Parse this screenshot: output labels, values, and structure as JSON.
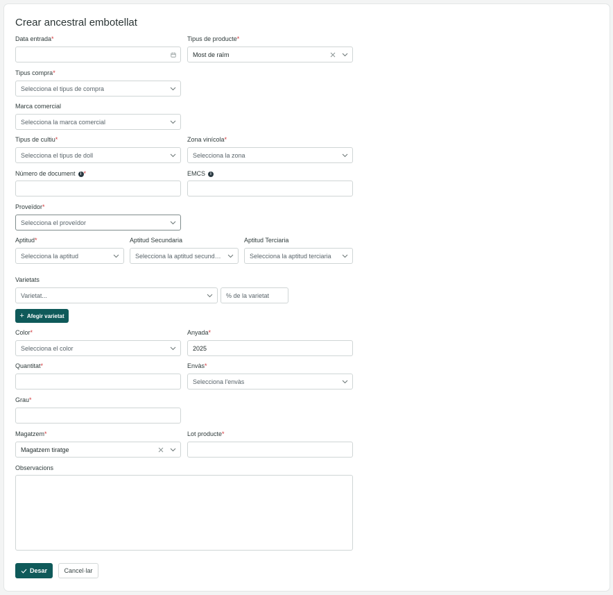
{
  "page": {
    "title": "Crear ancestral embotellat"
  },
  "fields": {
    "data_entrada": {
      "label": "Data entrada",
      "value": ""
    },
    "tipus_producte": {
      "label": "Tipus de producte",
      "value": "Most de raïm"
    },
    "tipus_compra": {
      "label": "Tipus compra",
      "placeholder": "Selecciona el tipus de compra"
    },
    "marca_comercial": {
      "label": "Marca comercial",
      "placeholder": "Selecciona la marca comercial"
    },
    "tipus_cultiu": {
      "label": "Tipus de cultiu",
      "placeholder": "Selecciona el tipus de doll"
    },
    "zona_vinicola": {
      "label": "Zona vinícola",
      "placeholder": "Selecciona la zona"
    },
    "numero_document": {
      "label": "Número de document",
      "value": ""
    },
    "emcs": {
      "label": "EMCS",
      "value": ""
    },
    "proveidor": {
      "label": "Proveïdor",
      "placeholder": "Selecciona el proveïdor"
    },
    "aptitud": {
      "label": "Aptitud",
      "placeholder": "Selecciona la aptitud"
    },
    "aptitud_secundaria": {
      "label": "Aptitud Secundaria",
      "placeholder": "Selecciona la aptitud secundaria"
    },
    "aptitud_terciaria": {
      "label": "Aptitud Terciaria",
      "placeholder": "Selecciona la aptitud terciaria"
    },
    "varietats": {
      "label": "Varietats",
      "placeholder": "Varietat...",
      "percent_placeholder": "% de la varietat"
    },
    "color": {
      "label": "Color",
      "placeholder": "Selecciona el color"
    },
    "anyada": {
      "label": "Anyada",
      "value": "2025"
    },
    "quantitat": {
      "label": "Quantitat",
      "value": ""
    },
    "envas": {
      "label": "Envàs",
      "placeholder": "Selecciona l'envàs"
    },
    "grau": {
      "label": "Grau",
      "value": ""
    },
    "magatzem": {
      "label": "Magatzem",
      "value": "Magatzem tiratge"
    },
    "lot_producte": {
      "label": "Lot producte",
      "value": ""
    },
    "observacions": {
      "label": "Observacions",
      "value": ""
    }
  },
  "buttons": {
    "afegir_varietat": "Afegir varietat",
    "desar": "Desar",
    "cancelar": "Cancel·lar"
  },
  "required_marker": "*",
  "colors": {
    "primary": "#0f5a5a",
    "required": "#d13438",
    "border": "#cfd5d5"
  }
}
